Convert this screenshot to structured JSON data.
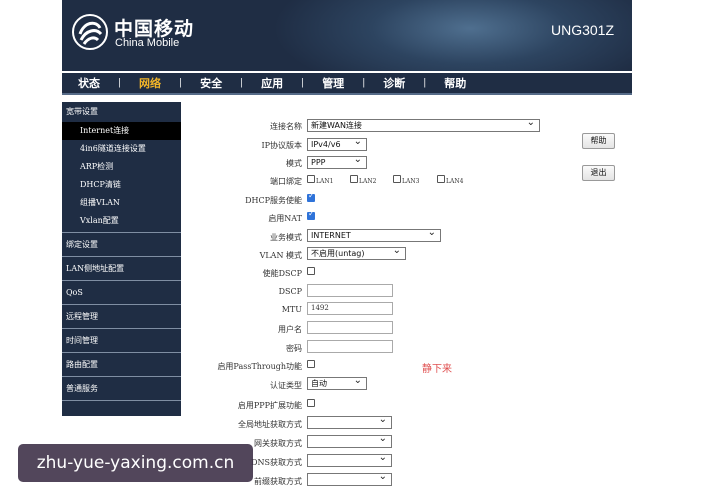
{
  "header": {
    "brand_cn": "中国移动",
    "brand_en": "China Mobile",
    "model": "UNG301Z"
  },
  "nav": {
    "items": [
      "状态",
      "网络",
      "安全",
      "应用",
      "管理",
      "诊断",
      "帮助"
    ],
    "active": "网络"
  },
  "sidebar": {
    "group_top": "宽带设置",
    "subitems": [
      "Internet连接",
      "4in6隧道连接设置",
      "ARP检测",
      "DHCP清链",
      "组播VLAN",
      "Vxlan配置"
    ],
    "groups": [
      "绑定设置",
      "LAN侧地址配置",
      "QoS",
      "远程管理",
      "时间管理",
      "路由配置",
      "普通服务"
    ]
  },
  "form": {
    "conn_name_label": "连接名称",
    "conn_name_value": "新建WAN连接",
    "ip_ver_label": "IP协议版本",
    "ip_ver_value": "IPv4/v6",
    "mode_label": "模式",
    "mode_value": "PPP",
    "port_bind_label": "端口绑定",
    "lan_labels": [
      "LAN1",
      "LAN2",
      "LAN3",
      "LAN4"
    ],
    "dhcp_label": "DHCP服务使能",
    "nat_label": "启用NAT",
    "service_label": "业务模式",
    "service_value": "INTERNET",
    "vlan_label": "VLAN 模式",
    "vlan_value": "不启用(untag)",
    "dscp_enable_label": "使能DSCP",
    "dscp_label": "DSCP",
    "mtu_label": "MTU",
    "mtu_value": "1492",
    "user_label": "用户名",
    "pwd_label": "密码",
    "passthrough_label": "启用PassThrough功能",
    "auth_label": "认证类型",
    "auth_value": "自动",
    "ppp_ext_label": "启用PPP扩展功能",
    "g_addr_label": "全局地址获取方式",
    "gw_label": "网关获取方式",
    "dns_label": "DNS获取方式",
    "prefix_label": "前缀获取方式"
  },
  "buttons": {
    "help": "帮助",
    "logout": "退出"
  },
  "overlays": {
    "watermark": "静下来",
    "url": "zhu-yue-yaxing.com.cn"
  }
}
